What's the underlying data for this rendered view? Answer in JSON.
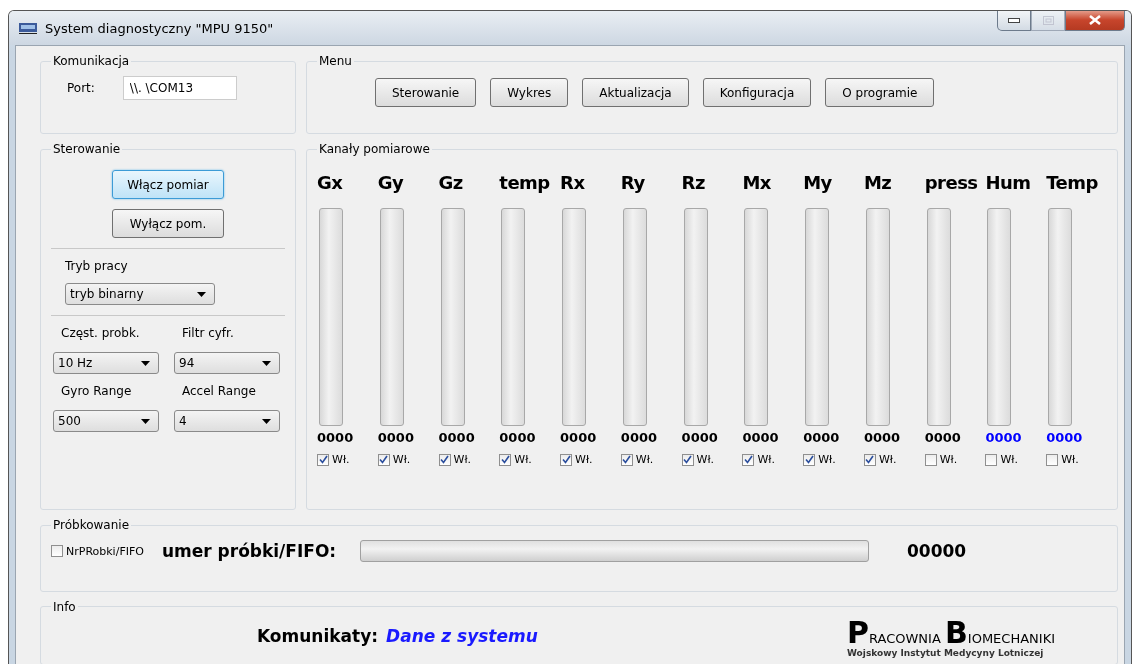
{
  "window": {
    "title": "System diagnostyczny \"MPU 9150\"",
    "controls": [
      {
        "kind": "minimize",
        "disabled": false
      },
      {
        "kind": "maximize",
        "disabled": true
      },
      {
        "kind": "close",
        "disabled": false
      }
    ]
  },
  "komunikacja": {
    "title": "Komunikacja",
    "port_label": "Port:",
    "port_value": "\\\\. \\COM13"
  },
  "menu": {
    "title": "Menu",
    "buttons": [
      "Sterowanie",
      "Wykres",
      "Aktualizacja",
      "Konfiguracja",
      "O programie"
    ]
  },
  "sterowanie": {
    "title": "Sterowanie",
    "buttons": [
      {
        "label": "Włącz pomiar",
        "focused": true
      },
      {
        "label": "Wyłącz pom.",
        "focused": false
      }
    ],
    "tryb": {
      "label": "Tryb pracy",
      "value": "tryb binarny"
    },
    "selects": [
      {
        "label": "Częst. probk.",
        "value": "10 Hz"
      },
      {
        "label": "Filtr cyfr.",
        "value": "94"
      },
      {
        "label": "Gyro Range",
        "value": "500"
      },
      {
        "label": "Accel Range",
        "value": "4"
      }
    ]
  },
  "kanaly": {
    "title": "Kanały pomiarowe",
    "channels": [
      {
        "name": "Gx",
        "reading": "0000",
        "color": "#000000",
        "checkbox": "Wł.",
        "checked": true
      },
      {
        "name": "Gy",
        "reading": "0000",
        "color": "#000000",
        "checkbox": "Wł.",
        "checked": true
      },
      {
        "name": "Gz",
        "reading": "0000",
        "color": "#000000",
        "checkbox": "Wł.",
        "checked": true
      },
      {
        "name": "temp",
        "reading": "0000",
        "color": "#000000",
        "checkbox": "Wł.",
        "checked": true
      },
      {
        "name": "Rx",
        "reading": "0000",
        "color": "#000000",
        "checkbox": "Wł.",
        "checked": true
      },
      {
        "name": "Ry",
        "reading": "0000",
        "color": "#000000",
        "checkbox": "Wł.",
        "checked": true
      },
      {
        "name": "Rz",
        "reading": "0000",
        "color": "#000000",
        "checkbox": "Wł.",
        "checked": true
      },
      {
        "name": "Mx",
        "reading": "0000",
        "color": "#000000",
        "checkbox": "Wł.",
        "checked": true
      },
      {
        "name": "My",
        "reading": "0000",
        "color": "#000000",
        "checkbox": "Wł.",
        "checked": true
      },
      {
        "name": "Mz",
        "reading": "0000",
        "color": "#000000",
        "checkbox": "Wł.",
        "checked": true
      },
      {
        "name": "press",
        "reading": "0000",
        "color": "#000000",
        "checkbox": "Wł.",
        "checked": false
      },
      {
        "name": "Hum",
        "reading": "0000",
        "color": "#0000ff",
        "checkbox": "Wł.",
        "checked": false
      },
      {
        "name": "Temp",
        "reading": "0000",
        "color": "#0000ff",
        "checkbox": "Wł.",
        "checked": false
      }
    ]
  },
  "probkowanie": {
    "title": "Próbkowanie",
    "checkbox": {
      "label": "NrPRobki/FIFO",
      "checked": false
    },
    "label": "umer próbki/FIFO:",
    "reading": "00000"
  },
  "info": {
    "title": "Info",
    "label": "Komunikaty:",
    "message": "Dane z systemu",
    "logo": {
      "initial_1": "P",
      "rest_1": "RACOWNIA",
      "initial_2": "B",
      "rest_2": "IOMECHANIKI",
      "subtitle": "Wojskowy Instytut Medycyny Lotniczej"
    }
  }
}
